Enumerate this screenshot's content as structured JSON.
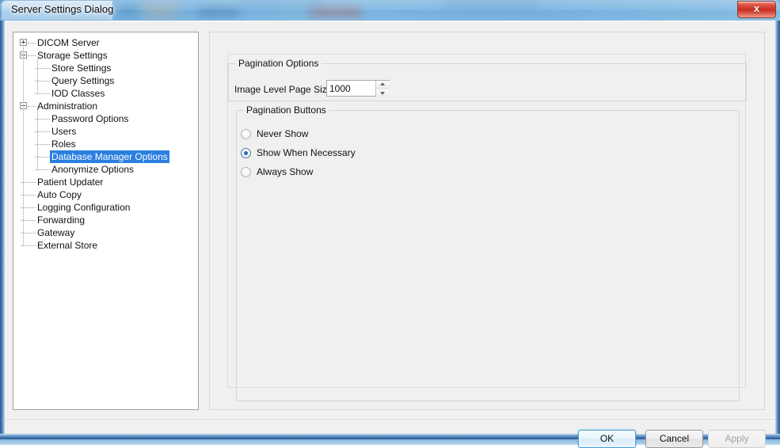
{
  "window": {
    "title": "Server Settings Dialog",
    "close_label": "x",
    "close_icon": "close-icon"
  },
  "tree": {
    "items": [
      {
        "label": "DICOM Server",
        "depth": 0,
        "toggle": "plus",
        "selected": false
      },
      {
        "label": "Storage Settings",
        "depth": 0,
        "toggle": "minus",
        "selected": false
      },
      {
        "label": "Store Settings",
        "depth": 1,
        "toggle": "none",
        "selected": false
      },
      {
        "label": "Query Settings",
        "depth": 1,
        "toggle": "none",
        "selected": false
      },
      {
        "label": "IOD Classes",
        "depth": 1,
        "toggle": "none",
        "selected": false
      },
      {
        "label": "Administration",
        "depth": 0,
        "toggle": "minus",
        "selected": false
      },
      {
        "label": "Password Options",
        "depth": 1,
        "toggle": "none",
        "selected": false
      },
      {
        "label": "Users",
        "depth": 1,
        "toggle": "none",
        "selected": false
      },
      {
        "label": "Roles",
        "depth": 1,
        "toggle": "none",
        "selected": false
      },
      {
        "label": "Database Manager Options",
        "depth": 1,
        "toggle": "none",
        "selected": true
      },
      {
        "label": "Anonymize Options",
        "depth": 1,
        "toggle": "none",
        "selected": false
      },
      {
        "label": "Patient Updater",
        "depth": 0,
        "toggle": "none",
        "selected": false
      },
      {
        "label": "Auto Copy",
        "depth": 0,
        "toggle": "none",
        "selected": false
      },
      {
        "label": "Logging Configuration",
        "depth": 0,
        "toggle": "none",
        "selected": false
      },
      {
        "label": "Forwarding",
        "depth": 0,
        "toggle": "none",
        "selected": false
      },
      {
        "label": "Gateway",
        "depth": 0,
        "toggle": "none",
        "selected": false
      },
      {
        "label": "External Store",
        "depth": 0,
        "toggle": "none",
        "selected": false
      }
    ],
    "selection_color": "#2a7fe0"
  },
  "pagination_options": {
    "group_title": "Pagination Options",
    "page_size_label": "Image Level Page Size",
    "page_size_value": "1000",
    "spin_up_icon": "chevron-up-icon",
    "spin_down_icon": "chevron-down-icon"
  },
  "pagination_buttons": {
    "group_title": "Pagination Buttons",
    "options": [
      {
        "label": "Never Show",
        "checked": false
      },
      {
        "label": "Show When Necessary",
        "checked": true
      },
      {
        "label": "Always Show",
        "checked": false
      }
    ],
    "checked_color": "#1f6fc4"
  },
  "footer": {
    "ok_label": "OK",
    "cancel_label": "Cancel",
    "apply_label": "Apply",
    "apply_enabled": false
  }
}
